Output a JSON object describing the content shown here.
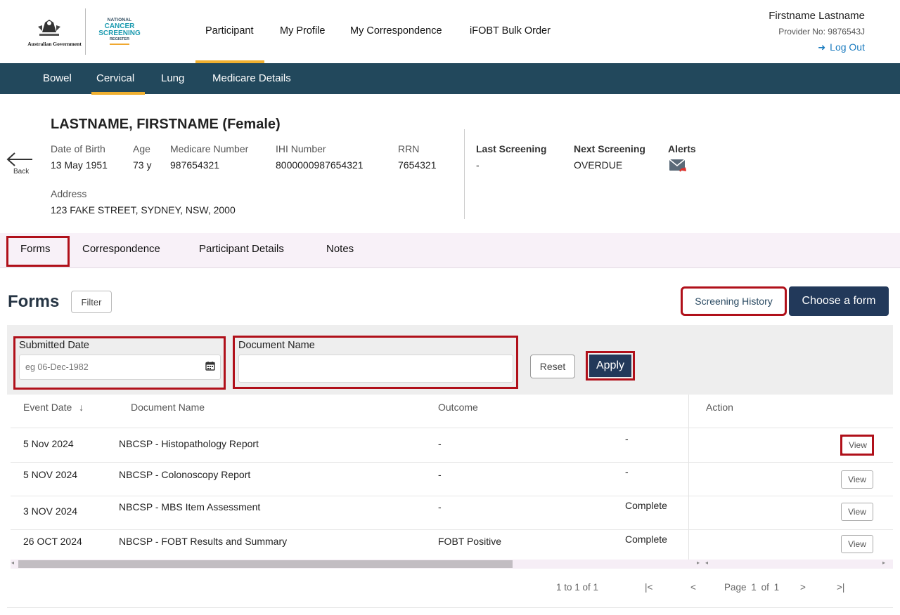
{
  "header": {
    "gov_name": "Australian Government",
    "ncsr_logo": [
      "NATIONAL",
      "CANCER",
      "SCREENING",
      "REGISTER"
    ],
    "nav": [
      "Participant",
      "My Profile",
      "My Correspondence",
      "iFOBT Bulk Order"
    ],
    "active_nav": "Participant",
    "user_name": "Firstname Lastname",
    "provider_no": "Provider No: 9876543J",
    "logout_label": "Log Out"
  },
  "subnav": {
    "items": [
      "Bowel",
      "Cervical",
      "Lung",
      "Medicare Details"
    ],
    "active": "Cervical"
  },
  "participant": {
    "back_label": "Back",
    "name": "LASTNAME, FIRSTNAME (Female)",
    "dob_label": "Date of Birth",
    "dob": "13 May 1951",
    "age_label": "Age",
    "age": "73 y",
    "medicare_label": "Medicare Number",
    "medicare": "987654321",
    "ihi_label": "IHI Number",
    "ihi": "8000000987654321",
    "rrn_label": "RRN",
    "rrn": "7654321",
    "address_label": "Address",
    "address": "123 FAKE STREET, SYDNEY, NSW, 2000",
    "last_screening_label": "Last Screening",
    "last_screening": "-",
    "next_screening_label": "Next Screening",
    "next_screening": "OVERDUE",
    "alerts_label": "Alerts"
  },
  "tabs": {
    "items": [
      "Forms",
      "Correspondence",
      "Participant Details",
      "Notes"
    ],
    "active": "Forms"
  },
  "forms": {
    "title": "Forms",
    "filter_label": "Filter",
    "screening_history_label": "Screening History",
    "choose_form_label": "Choose a form",
    "filter_panel": {
      "submitted_date_label": "Submitted Date",
      "submitted_date_placeholder": "eg 06-Dec-1982",
      "document_name_label": "Document Name",
      "document_name_value": "",
      "reset_label": "Reset",
      "apply_label": "Apply"
    },
    "table": {
      "headers": [
        "Event Date",
        "Document Name",
        "Outcome",
        "Action"
      ],
      "sort_indicator": "↓",
      "rows": [
        {
          "date": "5 Nov 2024",
          "document": "NBCSP - Histopathology Report",
          "outcome": "-",
          "status": "-",
          "action": "View"
        },
        {
          "date": "5 NOV 2024",
          "document": "NBCSP - Colonoscopy Report",
          "outcome": "-",
          "status": "-",
          "action": "View"
        },
        {
          "date": "3 NOV 2024",
          "document": "NBCSP - MBS Item Assessment",
          "outcome": "-",
          "status": "Complete",
          "action": "View"
        },
        {
          "date": "26 OCT 2024",
          "document": "NBCSP - FOBT Results and Summary",
          "outcome": "FOBT Positive",
          "status": "Complete",
          "action": "View"
        }
      ]
    },
    "pagination": {
      "range": "1 to 1 of 1",
      "first": "|<",
      "prev": "<",
      "page_label": "Page",
      "page": "1",
      "of_label": "of",
      "total_pages": "1",
      "next": ">",
      "last": ">|"
    }
  },
  "icons": {
    "back": "left-arrow-icon",
    "logout": "logout-icon",
    "alerts": "mail-alert-icon",
    "calendar": "calendar-icon",
    "sort": "sort-arrow-icon"
  },
  "colors": {
    "subnav_bg": "#22485c",
    "accent_bar": "#f0b030",
    "primary_button": "#22395a",
    "highlight_box": "#b0101a",
    "link": "#1a7bbf",
    "tabs_bg": "#f8f1f8"
  }
}
